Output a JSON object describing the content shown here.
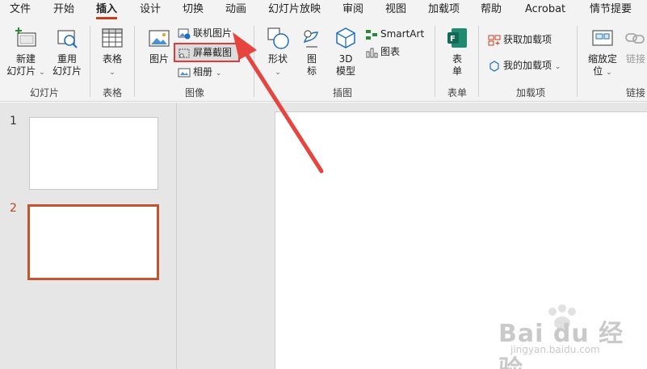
{
  "tabs": [
    "文件",
    "开始",
    "插入",
    "设计",
    "切换",
    "动画",
    "幻灯片放映",
    "审阅",
    "视图",
    "加载项",
    "帮助",
    "Acrobat",
    "情节提要"
  ],
  "active_tab": "插入",
  "groups": {
    "slides": {
      "label": "幻灯片",
      "new_slide": [
        "新建",
        "幻灯片"
      ],
      "reuse_slide": [
        "重用",
        "幻灯片"
      ]
    },
    "table": {
      "label": "表格",
      "table_btn": "表格"
    },
    "images": {
      "label": "图像",
      "picture": "图片",
      "online_picture": "联机图片",
      "screenshot": "屏幕截图",
      "album": "相册"
    },
    "illustrations": {
      "label": "插图",
      "shapes": "形状",
      "icons": [
        "图",
        "标"
      ],
      "model3d": [
        "3D",
        "模型"
      ],
      "smartart": "SmartArt",
      "chart": "图表"
    },
    "forms": {
      "label": "表单",
      "form": [
        "表",
        "单"
      ]
    },
    "addins": {
      "label": "加载项",
      "get_addins": "获取加载项",
      "my_addins": "我的加载项"
    },
    "links": {
      "label": "链接",
      "zoom": [
        "缩放定",
        "位"
      ],
      "link": "链接"
    }
  },
  "slides": [
    {
      "number": "1"
    },
    {
      "number": "2"
    }
  ],
  "selected_slide": "2",
  "accent_color": "#c43e1c",
  "annotation_color": "#e03b3b",
  "watermark": {
    "text": "Bai du 经验",
    "sub": "jingyan.baidu.com"
  }
}
